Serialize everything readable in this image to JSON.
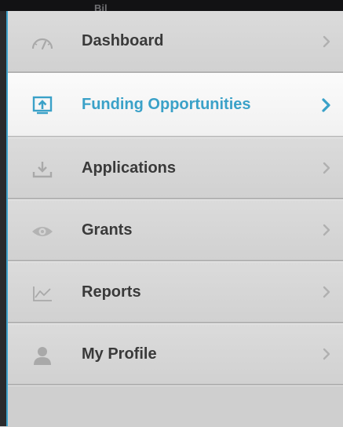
{
  "topbar": {
    "partial_text": "Bil"
  },
  "menu": {
    "items": [
      {
        "label": "Dashboard",
        "icon": "dashboard-gauge-icon",
        "active": false
      },
      {
        "label": "Funding Opportunities",
        "icon": "upload-box-icon",
        "active": true
      },
      {
        "label": "Applications",
        "icon": "download-tray-icon",
        "active": false
      },
      {
        "label": "Grants",
        "icon": "eye-icon",
        "active": false
      },
      {
        "label": "Reports",
        "icon": "line-chart-icon",
        "active": false
      },
      {
        "label": "My Profile",
        "icon": "user-icon",
        "active": false
      }
    ]
  },
  "colors": {
    "accent": "#3aa1c8",
    "menu_bg": "#d6d6d6",
    "active_bg": "#f7f7f7",
    "text": "#3a3a3a",
    "muted_icon": "#a9a9a9"
  }
}
